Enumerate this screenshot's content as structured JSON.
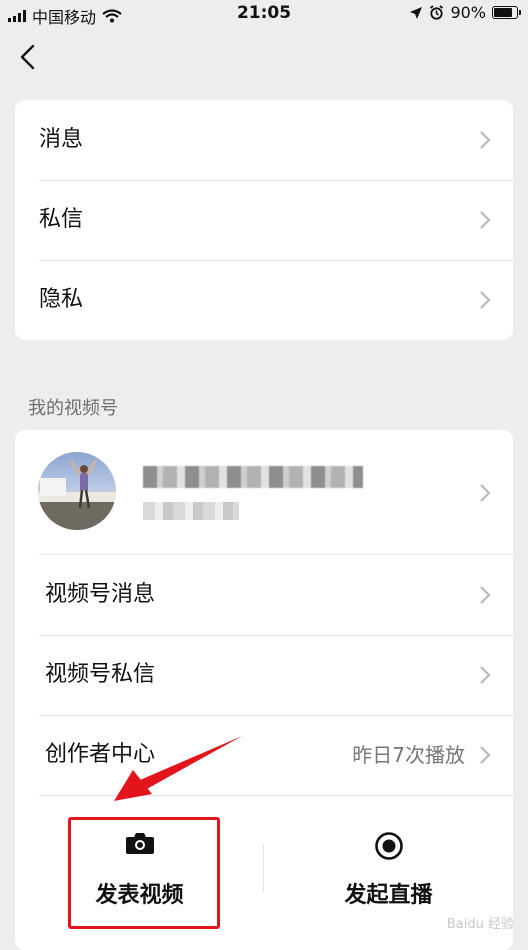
{
  "status_bar": {
    "carrier": "中国移动",
    "time": "21:05",
    "battery": "90%",
    "battery_level": 0.9
  },
  "settings_rows": [
    {
      "label": "消息"
    },
    {
      "label": "私信"
    },
    {
      "label": "隐私"
    }
  ],
  "section_title": "我的视频号",
  "channel_rows": [
    {
      "label": "视频号消息",
      "value": ""
    },
    {
      "label": "视频号私信",
      "value": ""
    },
    {
      "label": "创作者中心",
      "value": "昨日7次播放"
    }
  ],
  "actions": {
    "publish_label": "发表视频",
    "live_label": "发起直播"
  },
  "watermark": "Baidu 经验",
  "colors": {
    "highlight": "#e3141b",
    "arrow": "#e3141b"
  }
}
